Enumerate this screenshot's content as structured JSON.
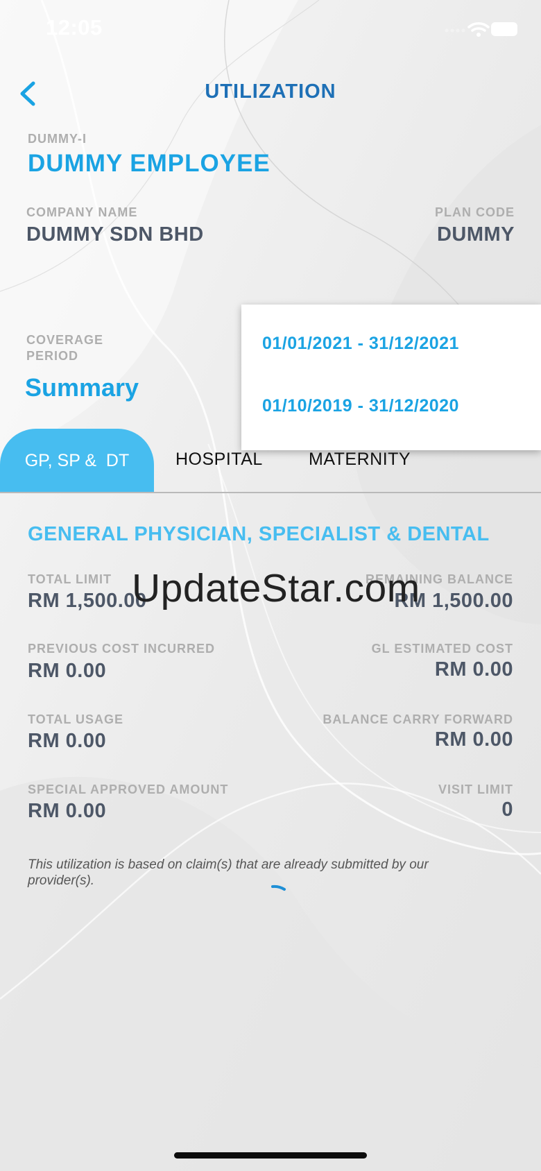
{
  "status_bar": {
    "time": "12:05"
  },
  "header": {
    "title": "UTILIZATION"
  },
  "employee": {
    "id_label": "DUMMY-I",
    "name": "DUMMY EMPLOYEE"
  },
  "company": {
    "label": "COMPANY NAME",
    "value": "DUMMY SDN BHD"
  },
  "plan": {
    "label": "PLAN CODE",
    "value": "DUMMY"
  },
  "coverage": {
    "label": "COVERAGE PERIOD",
    "view": "Summary"
  },
  "period_dropdown": {
    "options": [
      "01/01/2021 - 31/12/2021",
      "01/10/2019 - 31/12/2020"
    ]
  },
  "tabs": [
    {
      "label": "GP, SP &  DT",
      "active": true
    },
    {
      "label": "HOSPITAL",
      "active": false
    },
    {
      "label": "MATERNITY",
      "active": false
    }
  ],
  "section": {
    "title": "GENERAL PHYSICIAN, SPECIALIST & DENTAL"
  },
  "fields": {
    "total_limit": {
      "label": "TOTAL LIMIT",
      "value": "RM 1,500.00"
    },
    "remaining_balance": {
      "label": "REMAINING BALANCE",
      "value": "RM 1,500.00"
    },
    "previous_cost": {
      "label": "PREVIOUS COST INCURRED",
      "value": "RM 0.00"
    },
    "gl_estimated": {
      "label": "GL ESTIMATED COST",
      "value": "RM 0.00"
    },
    "total_usage": {
      "label": "TOTAL USAGE",
      "value": "RM 0.00"
    },
    "carry_forward": {
      "label": "BALANCE CARRY FORWARD",
      "value": "RM 0.00"
    },
    "special_approved": {
      "label": "SPECIAL APPROVED AMOUNT",
      "value": "RM 0.00"
    },
    "visit_limit": {
      "label": "VISIT LIMIT",
      "value": "0"
    }
  },
  "note": "This utilization is based on claim(s) that are already submitted by our provider(s).",
  "watermark": "UpdateStar.com",
  "colors": {
    "accent": "#1aa3e3",
    "tab_active": "#47bdf0",
    "title": "#1e70b6",
    "value_text": "#4d5767",
    "label_text": "#aeaeae"
  },
  "icons": [
    "wifi-icon",
    "battery-icon",
    "back-chevron-icon",
    "loading-spinner-icon"
  ]
}
